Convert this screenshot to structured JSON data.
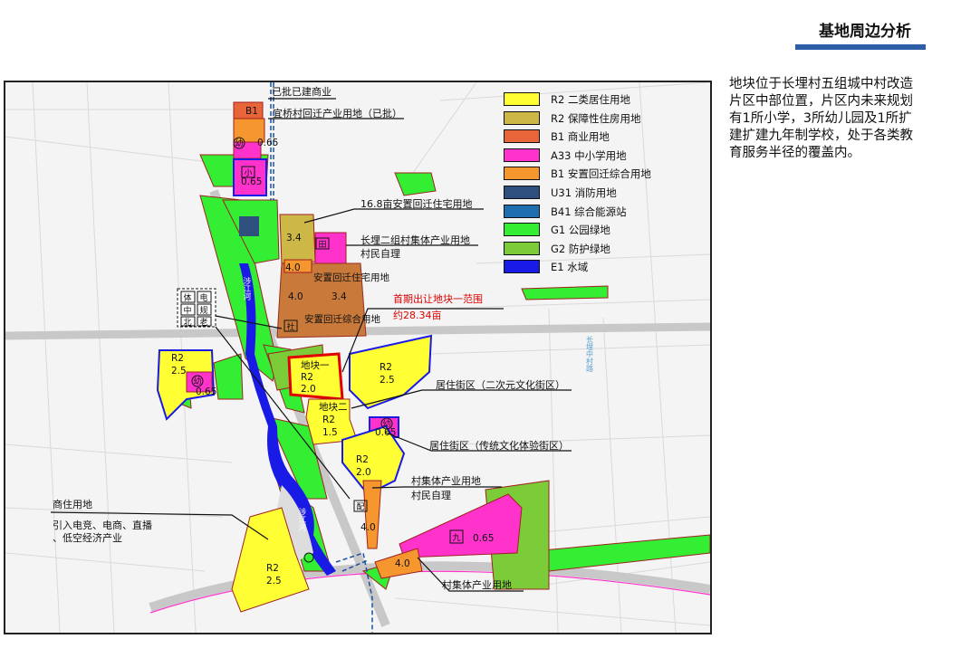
{
  "page": {
    "title": "基地周边分析",
    "title_bar_color": "#2e5ea8",
    "description": "地块位于长埋村五组城中村改造片区中部位置，片区内未来规划有1所小学，3所幼儿园及1所扩建扩建九年制学校，处于各类教育服务半径的覆盖内。"
  },
  "legend": [
    {
      "code_label": "R2 二类居住用地",
      "color": "#ffff33"
    },
    {
      "code_label": "R2 保障性住房用地",
      "color": "#cdb847"
    },
    {
      "code_label": "B1 商业用地",
      "color": "#e8653a"
    },
    {
      "code_label": "A33 中小学用地",
      "color": "#ff33cc"
    },
    {
      "code_label": "B1 安置回迁综合用地",
      "color": "#f5962f"
    },
    {
      "code_label": "U31 消防用地",
      "color": "#2f4f7f"
    },
    {
      "code_label": "B41 综合能源站",
      "color": "#1f6fb0"
    },
    {
      "code_label": "G1 公园绿地",
      "color": "#33ee33"
    },
    {
      "code_label": "G2 防护绿地",
      "color": "#7ccc3a"
    },
    {
      "code_label": "E1 水域",
      "color": "#1a1ae6"
    }
  ],
  "annotations": {
    "approved_commercial": "已批已建商业",
    "relocation_industry": "宜桥村回迁产业用地（已批）",
    "relocation_housing": "16.8亩安置回迁住宅用地",
    "collective_industry_2": "长埋二组村集体产业用地",
    "villager_self_1": "村民自理",
    "first_transfer_title": "首期出让地块一范围",
    "first_transfer_area": "约28.34亩",
    "residential_2d": "居住街区（二次元文化街区）",
    "residential_traditional": "居住街区（传统文化体验街区）",
    "collective_industry": "村集体产业用地",
    "villager_self_2": "村民自理",
    "commercial_residential": "商住用地",
    "commercial_residential_note": "引入电竞、电商、直播、低空经济产业",
    "collective_industry_3": "村集体产业用地"
  },
  "parcels": {
    "b1_top": "B1",
    "far_065_a": "0.65",
    "far_065_b": "0.65",
    "far_065_c": "0.65",
    "far_065_d": "0.65",
    "far_065_e": "0.65",
    "far_34_a": "3.4",
    "far_34_b": "3.4",
    "far_40_a": "4.0",
    "far_40_b": "4.0",
    "far_40_c": "4.0",
    "far_40_d": "4.0",
    "anzhi_label": "安置回迁住宅用地",
    "anzhi_zonghe": "安置回迁综合用地",
    "plot1": "地块一",
    "plot2": "地块二",
    "r2": "R2",
    "far_20": "2.0",
    "far_15": "1.5",
    "far_25": "2.5",
    "river": "涉江河",
    "xiao": "小",
    "jiu": "九",
    "you": "幼",
    "you2": "幼",
    "tian": "田",
    "ti": "体",
    "dian": "电",
    "she": "社",
    "zhong": "中",
    "pei": "配",
    "gui": "规",
    "lao": "老",
    "bei": "北",
    "vertical_road": "长埋中村路"
  }
}
